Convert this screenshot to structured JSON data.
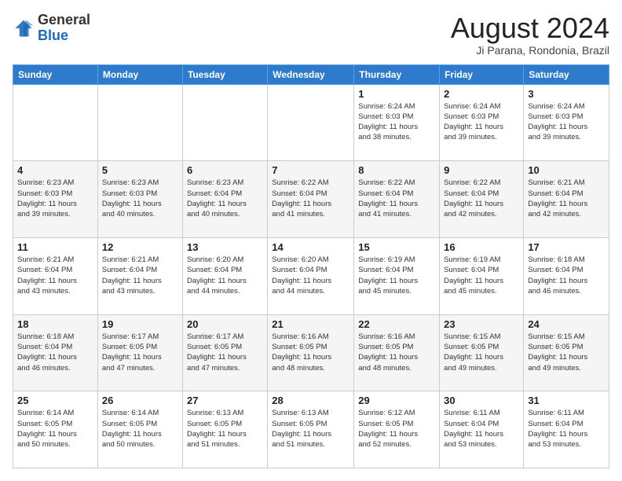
{
  "header": {
    "logo_line1": "General",
    "logo_line2": "Blue",
    "month_title": "August 2024",
    "location": "Ji Parana, Rondonia, Brazil"
  },
  "days_of_week": [
    "Sunday",
    "Monday",
    "Tuesday",
    "Wednesday",
    "Thursday",
    "Friday",
    "Saturday"
  ],
  "weeks": [
    [
      {
        "day": "",
        "info": ""
      },
      {
        "day": "",
        "info": ""
      },
      {
        "day": "",
        "info": ""
      },
      {
        "day": "",
        "info": ""
      },
      {
        "day": "1",
        "info": "Sunrise: 6:24 AM\nSunset: 6:03 PM\nDaylight: 11 hours\nand 38 minutes."
      },
      {
        "day": "2",
        "info": "Sunrise: 6:24 AM\nSunset: 6:03 PM\nDaylight: 11 hours\nand 39 minutes."
      },
      {
        "day": "3",
        "info": "Sunrise: 6:24 AM\nSunset: 6:03 PM\nDaylight: 11 hours\nand 39 minutes."
      }
    ],
    [
      {
        "day": "4",
        "info": "Sunrise: 6:23 AM\nSunset: 6:03 PM\nDaylight: 11 hours\nand 39 minutes."
      },
      {
        "day": "5",
        "info": "Sunrise: 6:23 AM\nSunset: 6:03 PM\nDaylight: 11 hours\nand 40 minutes."
      },
      {
        "day": "6",
        "info": "Sunrise: 6:23 AM\nSunset: 6:04 PM\nDaylight: 11 hours\nand 40 minutes."
      },
      {
        "day": "7",
        "info": "Sunrise: 6:22 AM\nSunset: 6:04 PM\nDaylight: 11 hours\nand 41 minutes."
      },
      {
        "day": "8",
        "info": "Sunrise: 6:22 AM\nSunset: 6:04 PM\nDaylight: 11 hours\nand 41 minutes."
      },
      {
        "day": "9",
        "info": "Sunrise: 6:22 AM\nSunset: 6:04 PM\nDaylight: 11 hours\nand 42 minutes."
      },
      {
        "day": "10",
        "info": "Sunrise: 6:21 AM\nSunset: 6:04 PM\nDaylight: 11 hours\nand 42 minutes."
      }
    ],
    [
      {
        "day": "11",
        "info": "Sunrise: 6:21 AM\nSunset: 6:04 PM\nDaylight: 11 hours\nand 43 minutes."
      },
      {
        "day": "12",
        "info": "Sunrise: 6:21 AM\nSunset: 6:04 PM\nDaylight: 11 hours\nand 43 minutes."
      },
      {
        "day": "13",
        "info": "Sunrise: 6:20 AM\nSunset: 6:04 PM\nDaylight: 11 hours\nand 44 minutes."
      },
      {
        "day": "14",
        "info": "Sunrise: 6:20 AM\nSunset: 6:04 PM\nDaylight: 11 hours\nand 44 minutes."
      },
      {
        "day": "15",
        "info": "Sunrise: 6:19 AM\nSunset: 6:04 PM\nDaylight: 11 hours\nand 45 minutes."
      },
      {
        "day": "16",
        "info": "Sunrise: 6:19 AM\nSunset: 6:04 PM\nDaylight: 11 hours\nand 45 minutes."
      },
      {
        "day": "17",
        "info": "Sunrise: 6:18 AM\nSunset: 6:04 PM\nDaylight: 11 hours\nand 46 minutes."
      }
    ],
    [
      {
        "day": "18",
        "info": "Sunrise: 6:18 AM\nSunset: 6:04 PM\nDaylight: 11 hours\nand 46 minutes."
      },
      {
        "day": "19",
        "info": "Sunrise: 6:17 AM\nSunset: 6:05 PM\nDaylight: 11 hours\nand 47 minutes."
      },
      {
        "day": "20",
        "info": "Sunrise: 6:17 AM\nSunset: 6:05 PM\nDaylight: 11 hours\nand 47 minutes."
      },
      {
        "day": "21",
        "info": "Sunrise: 6:16 AM\nSunset: 6:05 PM\nDaylight: 11 hours\nand 48 minutes."
      },
      {
        "day": "22",
        "info": "Sunrise: 6:16 AM\nSunset: 6:05 PM\nDaylight: 11 hours\nand 48 minutes."
      },
      {
        "day": "23",
        "info": "Sunrise: 6:15 AM\nSunset: 6:05 PM\nDaylight: 11 hours\nand 49 minutes."
      },
      {
        "day": "24",
        "info": "Sunrise: 6:15 AM\nSunset: 6:05 PM\nDaylight: 11 hours\nand 49 minutes."
      }
    ],
    [
      {
        "day": "25",
        "info": "Sunrise: 6:14 AM\nSunset: 6:05 PM\nDaylight: 11 hours\nand 50 minutes."
      },
      {
        "day": "26",
        "info": "Sunrise: 6:14 AM\nSunset: 6:05 PM\nDaylight: 11 hours\nand 50 minutes."
      },
      {
        "day": "27",
        "info": "Sunrise: 6:13 AM\nSunset: 6:05 PM\nDaylight: 11 hours\nand 51 minutes."
      },
      {
        "day": "28",
        "info": "Sunrise: 6:13 AM\nSunset: 6:05 PM\nDaylight: 11 hours\nand 51 minutes."
      },
      {
        "day": "29",
        "info": "Sunrise: 6:12 AM\nSunset: 6:05 PM\nDaylight: 11 hours\nand 52 minutes."
      },
      {
        "day": "30",
        "info": "Sunrise: 6:11 AM\nSunset: 6:04 PM\nDaylight: 11 hours\nand 53 minutes."
      },
      {
        "day": "31",
        "info": "Sunrise: 6:11 AM\nSunset: 6:04 PM\nDaylight: 11 hours\nand 53 minutes."
      }
    ]
  ]
}
